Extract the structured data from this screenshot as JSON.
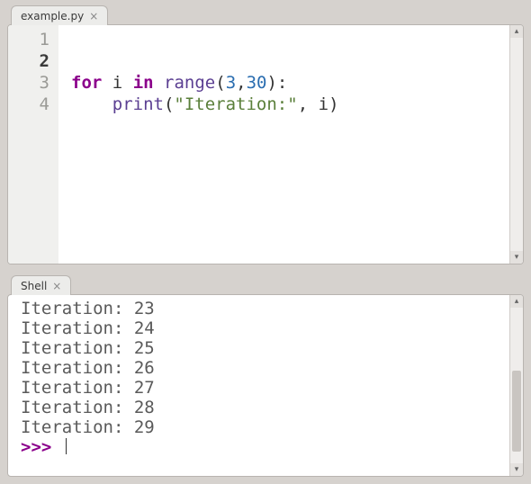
{
  "editor": {
    "tab_label": "example.py",
    "line_numbers": [
      "1",
      "2",
      "3",
      "4"
    ],
    "current_line_index": 1,
    "code": {
      "kw_for": "for",
      "var_i": "i",
      "kw_in": "in",
      "fn_range": "range",
      "open_paren": "(",
      "arg1": "3",
      "comma": ",",
      "arg2": "30",
      "close_paren_colon": "):",
      "fn_print": "print",
      "open_paren2": "(",
      "str_lit": "\"Iteration:\"",
      "comma2": ",",
      "var_i2": "i",
      "close_paren2": ")"
    }
  },
  "shell": {
    "tab_label": "Shell",
    "lines": [
      "Iteration: 23",
      "Iteration: 24",
      "Iteration: 25",
      "Iteration: 26",
      "Iteration: 27",
      "Iteration: 28",
      "Iteration: 29"
    ],
    "prompt": ">>> "
  }
}
